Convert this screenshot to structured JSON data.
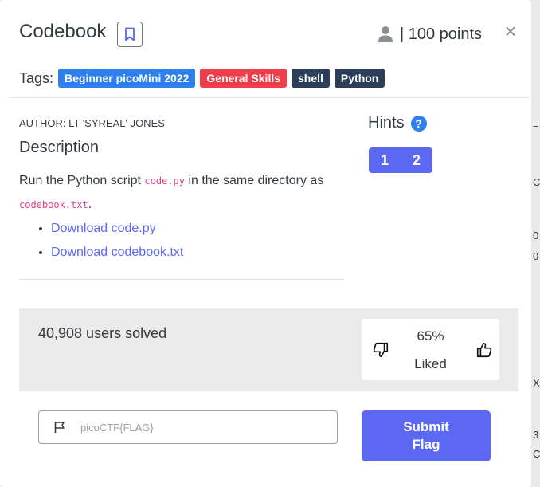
{
  "challenge": {
    "title": "Codebook",
    "points_label": "| 100 points",
    "close_glyph": "×"
  },
  "tags": {
    "label": "Tags:",
    "items": [
      {
        "text": "Beginner picoMini 2022",
        "color": "#2f80ed"
      },
      {
        "text": "General Skills",
        "color": "#ef3e4a"
      },
      {
        "text": "shell",
        "color": "#2c3e5a"
      },
      {
        "text": "Python",
        "color": "#2c3e5a"
      }
    ]
  },
  "author": "AUTHOR: LT 'SYREAL' JONES",
  "description": {
    "heading": "Description",
    "text_before": "Run the Python script ",
    "code1": "code.py",
    "text_middle": " in the same directory as ",
    "code2": "codebook.txt",
    "text_after": ".",
    "links": [
      "Download code.py",
      "Download codebook.txt"
    ]
  },
  "hints": {
    "heading": "Hints",
    "help_glyph": "?",
    "buttons": [
      "1",
      "2"
    ]
  },
  "stats": {
    "solved": "40,908 users solved",
    "liked_percent": "65%",
    "liked_label": "Liked"
  },
  "flag": {
    "placeholder": "picoCTF{FLAG}",
    "value": "",
    "submit_label_line1": "Submit",
    "submit_label_line2": "Flag"
  },
  "background_peek": [
    "=",
    "C",
    "0",
    "0",
    "X",
    "3",
    "C"
  ],
  "colors": {
    "accent": "#5c67f2",
    "tag_blue": "#2f80ed",
    "tag_red": "#ef3e4a",
    "tag_dark": "#2c3e5a",
    "code_pink": "#e83e8c"
  }
}
